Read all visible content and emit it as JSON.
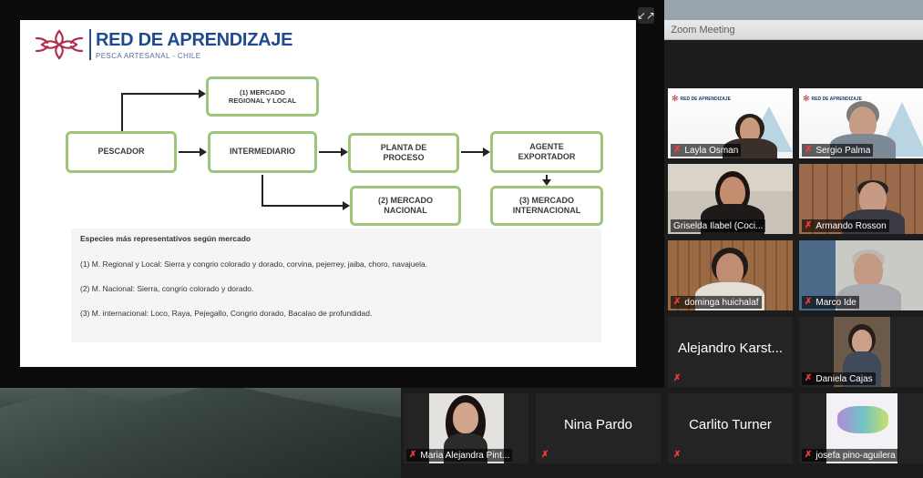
{
  "zoom": {
    "window_title": "Zoom Meeting",
    "topbar_marker": "g"
  },
  "slide": {
    "logo_title": "RED DE APRENDIZAJE",
    "logo_subtitle": "PESCA ARTESANAL - CHILE",
    "boxes": {
      "mercado_regional": "(1) MERCADO\nREGIONAL Y LOCAL",
      "pescador": "PESCADOR",
      "intermediario": "INTERMEDIARIO",
      "planta": "PLANTA DE\nPROCESO",
      "agente": "AGENTE\nEXPORTADOR",
      "mercado_nacional": "(2) MERCADO\nNACIONAL",
      "mercado_internacional": "(3) MERCADO\nINTERNACIONAL"
    },
    "species": {
      "title": "Especies más representativos según mercado",
      "lines": [
        "(1) M. Regional y Local: Sierra y congrio colorado y dorado, corvina, pejerrey, jaiba, choro, navajuela.",
        "(2) M. Nacional: Sierra, congrio colorado y dorado.",
        "(3) M. internacional: Loco, Raya, Pejegallo, Congrio dorado, Bacalao de profundidad."
      ]
    },
    "expand_icon": "↙↗"
  },
  "participants": [
    {
      "name": "Layla Osman",
      "muted": true,
      "video": true
    },
    {
      "name": "Sergio Palma",
      "muted": true,
      "video": true
    },
    {
      "name": "Griselda Ilabel (Coci...",
      "muted": false,
      "video": true,
      "active": true
    },
    {
      "name": "Armando Rosson",
      "muted": true,
      "video": true
    },
    {
      "name": "dominga huichalaf",
      "muted": true,
      "video": true
    },
    {
      "name": "Marco Ide",
      "muted": true,
      "video": true
    },
    {
      "name": "Alejandro Karst...",
      "muted": true,
      "video": false
    },
    {
      "name": "Daniela Cajas",
      "muted": true,
      "video": true
    },
    {
      "name": "Maria Alejandra Pint...",
      "muted": true,
      "video": true
    },
    {
      "name": "Nina Pardo",
      "muted": true,
      "video": false
    },
    {
      "name": "Carlito Turner",
      "muted": true,
      "video": false
    },
    {
      "name": "josefa pino-aguilera",
      "muted": true,
      "video": true
    }
  ],
  "colors": {
    "box_border": "#9cc47a",
    "logo_blue": "#1f4b8e",
    "logo_red": "#b03050",
    "active_speaker": "#b7d36a",
    "muted_red": "#ff3b30"
  }
}
